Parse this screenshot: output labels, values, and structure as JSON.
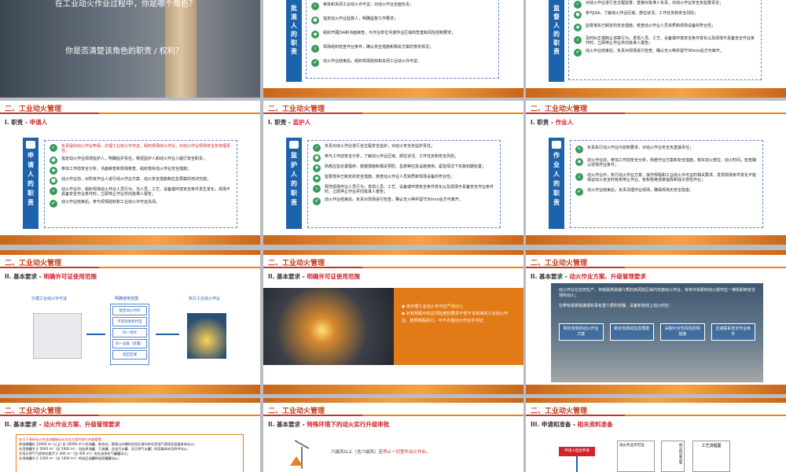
{
  "slides": {
    "s1": {
      "line1": "在工业动火作业过程中，你是哪个角色？",
      "line2": "你是否清楚该角色的职责 / 权利？"
    },
    "s2": {
      "side": "批准人的职责",
      "rows": [
        "审批和关闭工业动火许可证，对动火作业全面负责；",
        "指定动火作业监督人，明确监督工作要求；",
        "组织开展JSA和书面审查，与作业单位沟通作业区域的危害和风险控制要求；",
        "现场组织检查作业条件，确认安全措施和相关方案的落实情况；",
        "动火作业结束后，组织现场验收和关闭工业动火许可证。"
      ]
    },
    "s3": {
      "side": "监督人的职责",
      "rows": [
        "对动火作业进行全过程监督，直接对批准人负责，对动火作业安全负监督责任；",
        "参与JSA，了解动火作业区域、部位状况、工作任务和安全风险；",
        "监督落实已制定的安全措施，核查动火作业人员资质和现场设备的符合性；",
        "及时纠正或制止违章行为，发现人员、工艺、设备或环境安全条件变化以及现场不具备安全作业条件时，立即停止作业并向批准人报告；",
        "动火作业结束后，负责对现场进行检查，确认无火种并留守30min后方可离开。"
      ]
    },
    "s4": {
      "title": "二、工业动火管理",
      "sub": "I.  职责 - ",
      "subred": "申请人",
      "side": "申请人的职责",
      "rows": [
        "负责提出动火作业申请，办理工业动火许可证，组织现场动火作业，对动火作业现场安全负管理责任；",
        "指定动火作业现场监护人，明确监护责任，督促监护人和动火作业人履行安全职责；",
        "参加工作前安全分析，书面审查和现场核查，组织落实动火作业安全措施；",
        "动火作业前，对所有作业人进行动火作业方案、动火安全措施和应急预案的培训交底；",
        "动火作业中，组织现场动火作业人员行为。当人员、工艺、设备或环境安全条件发生变化，现场不具备安全作业条件时，立即停止作业并向批准人报告；",
        "动火作业结束后，参与现场验收和工业动火许可证关闭。"
      ]
    },
    "s5": {
      "title": "二、工业动火管理",
      "sub": "I.  职责 - ",
      "subred": "监护人",
      "side": "监护人的职责",
      "rows": [
        "负责对动火作业进行全过程安全监护，对动火安全负监护责任；",
        "参与工作前安全分析，了解动火作业区域、部位状况、工作任务和安全风险；",
        "熟悉应急处置程序、救援措施和相关预防、急救等应急设施使用，紧急情况下实施初期处置；",
        "监督落实已制定的安全措施，核查动火作业人员资质和现场设备的符合性；",
        "规范现场作业人员行为，发现人员、工艺、设备或环境安全条件变化以及现场不具备安全作业条件时，立即停止作业并向批准人报告；",
        "动火作业结束后，负责对现场进行检查，确认无火种并留守30min后方可离开。"
      ]
    },
    "s6": {
      "title": "二、工业动火管理",
      "sub": "I.  职责 - ",
      "subred": "作业人",
      "side": "作业人的职责",
      "rows": [
        "负责执行动火作业内容和要求，对动火作业安全负直接责任；",
        "动火作业前，参加工作前安全分析，熟悉作业方案和安全措施，核实动火部位、动火时间，检查确认现场作业条件；",
        "动火作业中，执行动火作业方案、操作规程和工业动火许可证的相关要求。发现现场条件变化不能保证动火安全时有权停止作业，有权拒绝违章指挥和强令冒险作业；",
        "动火作业结束后，负责清理作业现场，确保现场无安全隐患。"
      ]
    },
    "s7": {
      "title": "二、工业动火管理",
      "sub": "II.  基本要求 - ",
      "subred": "明确许可证使用范围",
      "l1": "办理工业动火许可证",
      "l2": "明确使用范围",
      "l3": "执行工业动火作业",
      "items": [
        "规定动火时间",
        "不得涂改和代签",
        "同一地点",
        "同一设备（装置）",
        "指定区域"
      ]
    },
    "s8": {
      "title": "二、工业动火管理",
      "sub": "II.  基本要求 - ",
      "subred": "明确许可证使用范围",
      "b1": "未办理工业动火许可证",
      "b1r": "严禁动火",
      "b2": "对有规程可依且风险管控要求不低于本标准的工业动火作业，按照规程执行，可不办理动火作业许可证"
    },
    "s9": {
      "title": "二、工业动火管理",
      "sub": "II.  基本要求 - ",
      "subred": "动火作业方案、升级管理要求",
      "p1": "动火作业在任何生产、存储易燃易爆介质的高风险区域内实施动火作业，有条件拆卸的动火部件应一律拆卸到安全场所动火；",
      "p2": "在带有易燃易爆或有毒有害介质的容器、设备和管线上动火时应：",
      "b": [
        "制定有效的动火作业方案",
        "制定有效的应急预案",
        "采取针对性风险控制措施",
        "迅速联系安全作业条件"
      ]
    },
    "s10": {
      "title": "二、工业动火管理",
      "sub": "II.  基本要求 - ",
      "subred": "动火作业方案、升级管理要求",
      "intro": "在以下场所动火作业应编制动火作业方案并进行升级管理：",
      "list": [
        "原油储罐在 10000 m³ 以上( 含 10000 m³) 的油罐、联合站，围堰以内爆炸危险区域内的在用油气管线及容器本体动火；",
        "在用储罐大于 5000 m³（含 5000 m³，包括原油罐、污油罐、含油污水罐、含天然气水罐）的容器本体及附件动火；",
        "在用天然气气质和钻管大于 400 m³（含 400 m³）的在油漆化气罐罐动火；",
        "在用储罐大于 1000 m³（含 1000 m³）的成品油罐和轻烃罐罐动火；"
      ]
    },
    "s11": {
      "title": "二、工业动火管理",
      "sub": "II.  基本要求 - ",
      "subred": "特殊环境下的动火实行升级审批",
      "text1": "六级风以上（含六级风）应",
      "text1r": "停止一切室外动火作业。"
    },
    "s12": {
      "title": "二、工业动火管理",
      "sub": "III.  申请和准备 - ",
      "subred": "相关资料准备",
      "a1": "申请人提出申请",
      "a2": "动火作业许可证",
      "a3": "动火作业方案",
      "a4": "工艺流程图"
    }
  },
  "colors": {
    "blue": "#1d62ad",
    "orange": "#e8841c",
    "red": "#d0242a",
    "green": "#3a9a5b"
  }
}
